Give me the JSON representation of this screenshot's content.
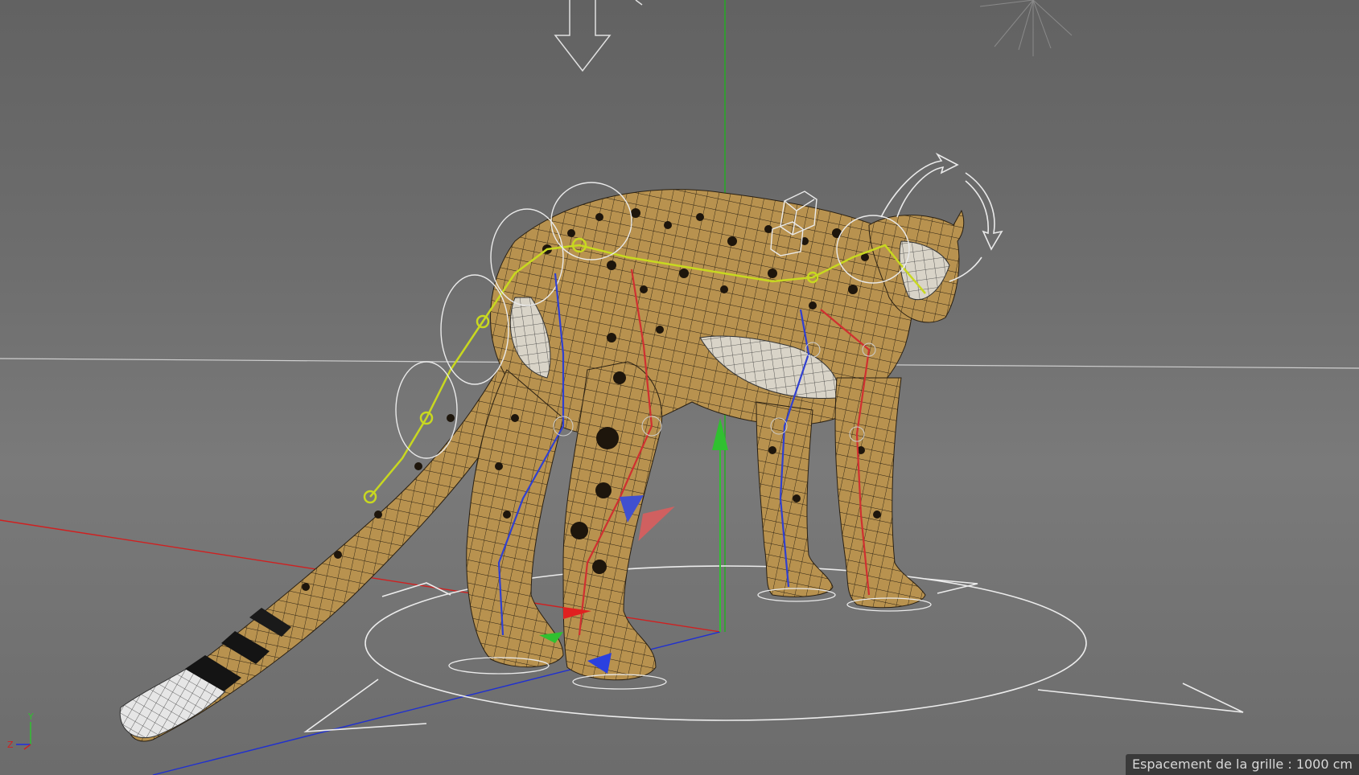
{
  "viewport": {
    "grid_spacing_label": "Espacement de la grille : 1000 cm"
  },
  "axis_gizmo": {
    "x_label": "X",
    "y_label": "Y",
    "z_label": "Z"
  },
  "colors": {
    "background": "#6e6e6e",
    "x_axis": "#e02020",
    "y_axis": "#20c020",
    "z_axis": "#2030e0",
    "spine_rig": "#c8d820",
    "left_leg_rig": "#3040d0",
    "right_leg_rig": "#d03030",
    "controller": "#e8e8e8",
    "fur": "#b8924f",
    "spots": "#1e160c",
    "horizon": "#cfcfcf"
  },
  "icons": {
    "light": "light-icon",
    "camera_arrow": "arrow-down-icon",
    "move_gizmo": "move-gizmo-icon",
    "root_controller": "root-controller-icon",
    "head_rotate": "rotate-gizmo-icon"
  }
}
